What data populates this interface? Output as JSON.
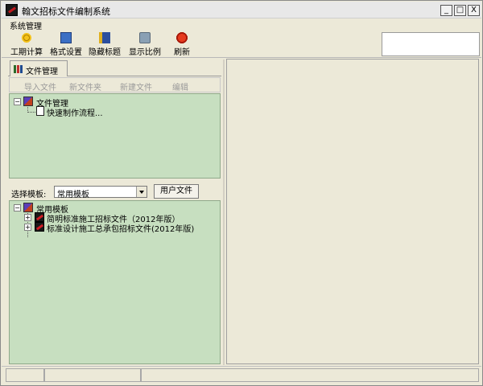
{
  "window": {
    "title": "翰文招标文件编制系统",
    "min_glyph": "_",
    "max_glyph": "□",
    "close_glyph": "X"
  },
  "menu": {
    "items": [
      "系统管理"
    ]
  },
  "toolbar": {
    "buttons": [
      {
        "label": "工期计算",
        "icon": "gear-icon"
      },
      {
        "label": "格式设置",
        "icon": "document-icon"
      },
      {
        "label": "隐藏标题",
        "icon": "book-icon"
      },
      {
        "label": "显示比例",
        "icon": "zoom-icon"
      },
      {
        "label": "刷新",
        "icon": "refresh-icon"
      }
    ],
    "search_value": ""
  },
  "file_panel": {
    "tab_label": "文件管理",
    "actions": [
      "导入文件",
      "新文件夹",
      "新建文件",
      "编辑"
    ],
    "tree": {
      "root": "文件管理",
      "children": [
        "快速制作流程..."
      ]
    }
  },
  "template_panel": {
    "select_label": "选择模板:",
    "selected_template": "常用模板",
    "user_files_button": "用户文件",
    "tree": {
      "root": "常用模板",
      "children": [
        "简明标准施工招标文件（2012年版）",
        "标准设计施工总承包招标文件(2012年版)"
      ]
    }
  },
  "status_bar": {
    "segments": [
      "",
      "",
      ""
    ]
  },
  "colors": {
    "tree_background": "#c7dfc0",
    "window_chrome": "#ece9d8",
    "disabled_text": "#9a9a9a"
  }
}
